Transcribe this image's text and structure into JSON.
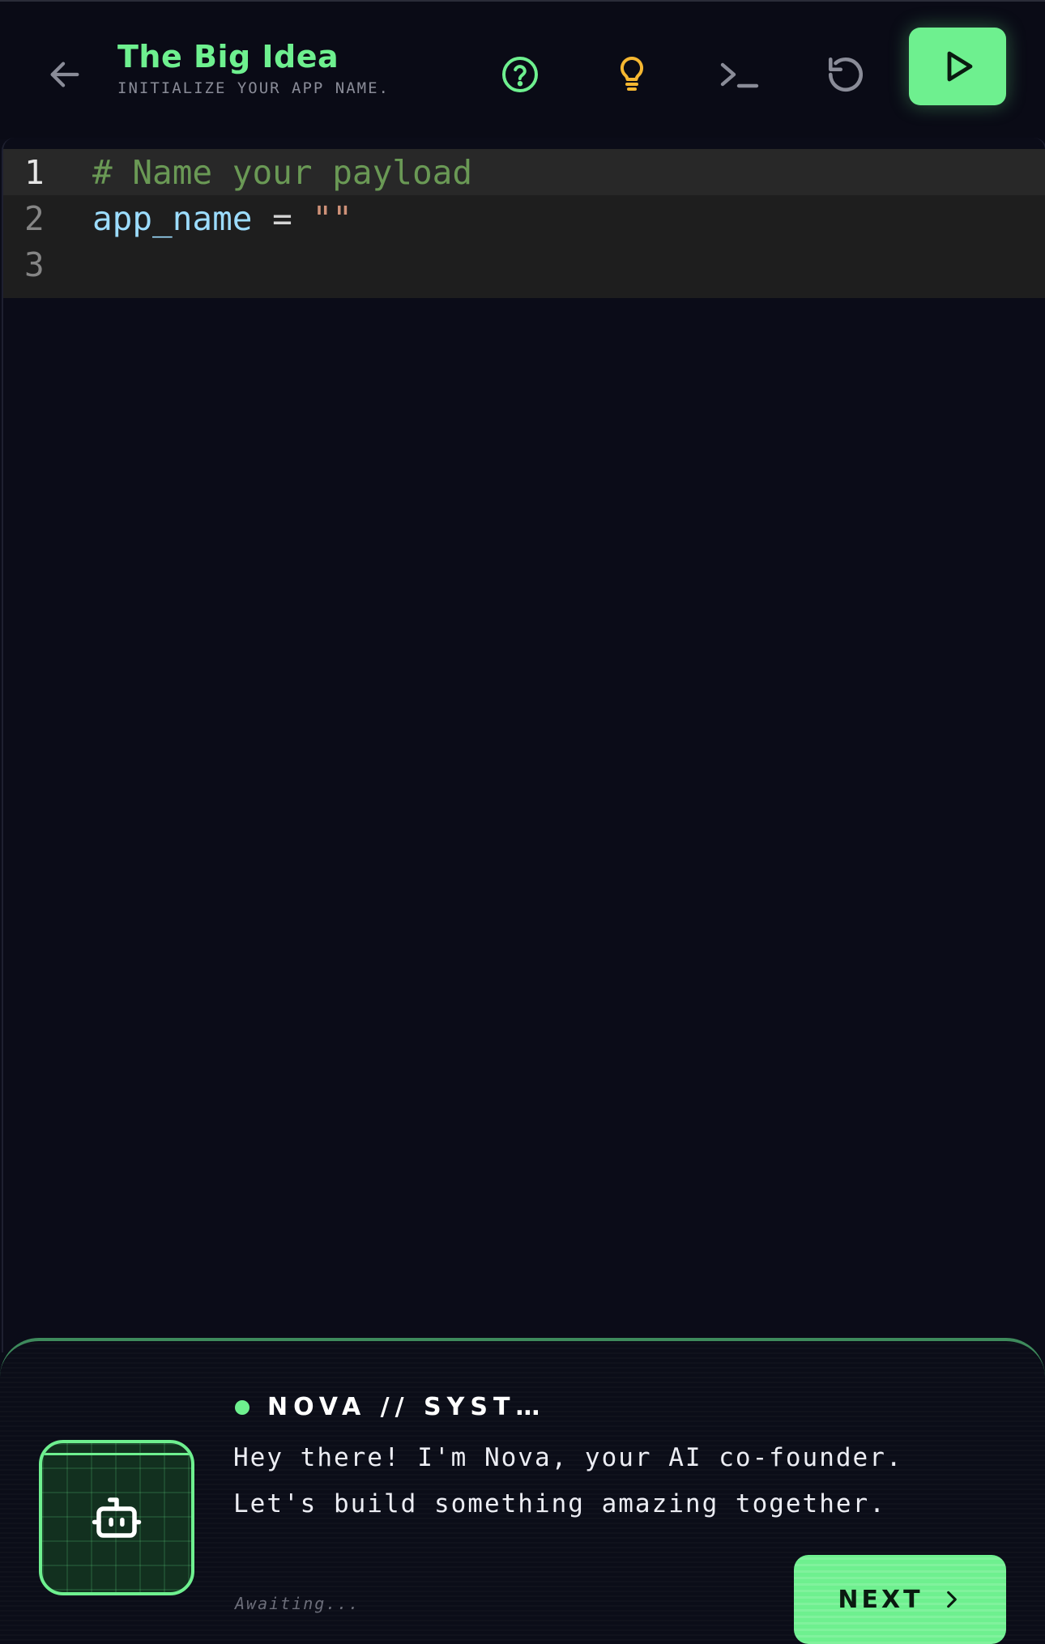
{
  "header": {
    "title": "The Big Idea",
    "subtitle": "INITIALIZE YOUR APP NAME.",
    "icons": {
      "back": "arrow-left-icon",
      "help": "help-circle-icon",
      "hint": "lightbulb-icon",
      "console": "terminal-icon",
      "reset": "rotate-ccw-icon",
      "run": "play-icon"
    }
  },
  "editor": {
    "lines": [
      {
        "number": "1",
        "comment": "# Name your payload"
      },
      {
        "number": "2",
        "variable": "app_name",
        "operator": " = ",
        "string": "\"\""
      },
      {
        "number": "3"
      }
    ]
  },
  "dialog": {
    "speaker": "NOVA // SYST…",
    "message": "Hey there! I'm Nova, your AI co-founder. Let's build something amazing together.",
    "status": "Awaiting...",
    "next_label": "NEXT",
    "avatar_icon": "robot-icon"
  },
  "colors": {
    "accent": "#6ef08f",
    "hint": "#f5b731",
    "background": "#0b0c18",
    "editor_bg": "#1e1e1e",
    "comment": "#6a9955",
    "variable": "#9cdcfe",
    "string": "#ce9178"
  }
}
